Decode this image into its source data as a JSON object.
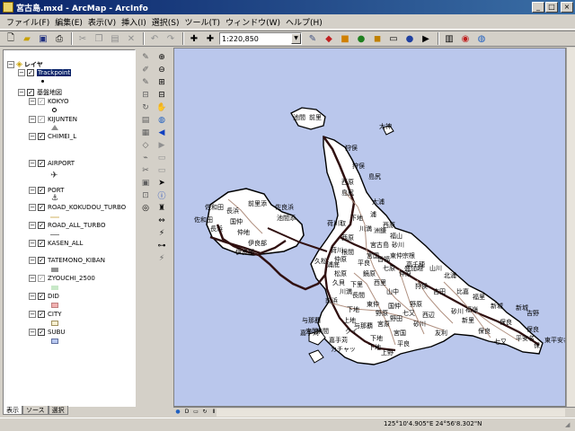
{
  "window": {
    "title": "宮古島.mxd - ArcMap - ArcInfo"
  },
  "menu": [
    "ファイル(F)",
    "編集(E)",
    "表示(V)",
    "挿入(I)",
    "選択(S)",
    "ツール(T)",
    "ウィンドウ(W)",
    "ヘルプ(H)"
  ],
  "toolbar": {
    "scale_value": "1:220,850"
  },
  "toc": {
    "root_label": "レイヤ",
    "group1": "Trackpoint",
    "group2": "基盤地図",
    "layers": [
      "KOKYO",
      "KIJUNTEN",
      "CHIMEI_L",
      "AIRPORT",
      "PORT",
      "ROAD_KOKUDOU_TURBO",
      "ROAD_ALL_TURBO",
      "KASEN_ALL",
      "TATEMONO_KIBAN",
      "ZYOUCHI_2500",
      "DID",
      "CITY",
      "SUBU"
    ],
    "tabs": [
      "表示",
      "ソース",
      "選択"
    ]
  },
  "map_labels": [
    "池間",
    "前里",
    "大神",
    "狩俣",
    "狩俣",
    "島尻",
    "西原",
    "島尻",
    "佐和田",
    "長浜",
    "前里添",
    "佐良浜",
    "池間添",
    "荷川取",
    "下地",
    "国仲",
    "仲地",
    "伊良部",
    "伊良部",
    "佐和田",
    "長浜",
    "大浦",
    "西原",
    "西原",
    "福山",
    "川満",
    "宮古島",
    "砂川",
    "久松",
    "平良",
    "東仲宗根",
    "下里",
    "西里",
    "鏡原",
    "仲原",
    "七原",
    "盛加越",
    "山川",
    "松原",
    "川満",
    "下地",
    "吉田",
    "比嘉",
    "福里",
    "新城",
    "保良",
    "与那覇",
    "嘉手苅",
    "宮国",
    "友利",
    "来間",
    "下地",
    "上地",
    "東仲",
    "山中",
    "野原",
    "野原",
    "狩俣",
    "新城",
    "砂川",
    "七又",
    "久貝",
    "来間",
    "国仲",
    "前浜",
    "長間",
    "保良",
    "吉野",
    "七又",
    "クイ",
    "西辺",
    "保良",
    "カチャッ",
    "荷川",
    "福嶺",
    "上野",
    "宮原",
    "嘉手苅",
    "洲鎌",
    "仲原",
    "下地",
    "浦底",
    "根間",
    "与那覇",
    "高千穂",
    "野田",
    "皆福",
    "平良",
    "宮国",
    "新里",
    "砂川",
    "平安名",
    "東平安名崎",
    "浦",
    "保",
    "北浦"
  ],
  "status": {
    "coords": "125°10'4.905\"E  24°56'8.302\"N"
  }
}
